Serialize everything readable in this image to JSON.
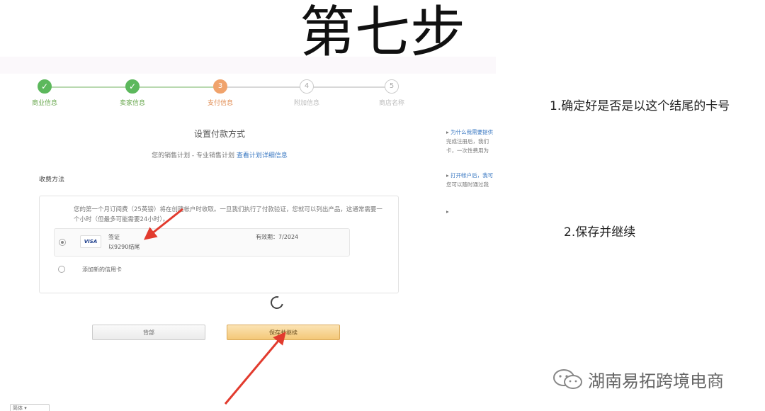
{
  "slide_title": "第七步",
  "steps": [
    {
      "label": "商业信息",
      "state": "done",
      "mark": "✓"
    },
    {
      "label": "卖家信息",
      "state": "done",
      "mark": "✓"
    },
    {
      "label": "支付信息",
      "state": "current",
      "mark": "3"
    },
    {
      "label": "附加信息",
      "state": "pending",
      "mark": "4"
    },
    {
      "label": "商店名称",
      "state": "pending",
      "mark": "5"
    }
  ],
  "payment": {
    "heading": "设置付款方式",
    "plan_text": "您的销售计划 - 专业销售计划",
    "plan_link": "查看计划详细信息",
    "section_label": "收费方法",
    "notice": "您的第一个月订阅费（25英镑）将在创建帐户时收取。一旦我们执行了付款验证，您就可以列出产品，这通常需要一个小时（但最多可能需要24小时）。",
    "card": {
      "brand": "VISA",
      "type": "签证",
      "last_digits": "以9290结尾",
      "expiry": "有效期：7/2024"
    },
    "add_card": "添加新的信用卡"
  },
  "buttons": {
    "back": "背部",
    "save": "保存并继续"
  },
  "aside": {
    "q1_link": "为什么我需要提供",
    "q1_text1": "完成注册后，我们",
    "q1_text2": "卡，一次性费用为",
    "q2_link": "打开帐户后，我可",
    "q2_text": "您可以随时通过我"
  },
  "bottom_select": "简体",
  "notes": {
    "note1": "1.确定好是否是以这个结尾的卡号",
    "note2": "2.保存并继续"
  },
  "watermark": "湖南易拓跨境电商",
  "colors": {
    "done_green": "#5cb85c",
    "current_orange": "#f0a36c",
    "save_button": "#f4c877",
    "arrow_red": "#e23b2e",
    "link_blue": "#3a78c2"
  }
}
